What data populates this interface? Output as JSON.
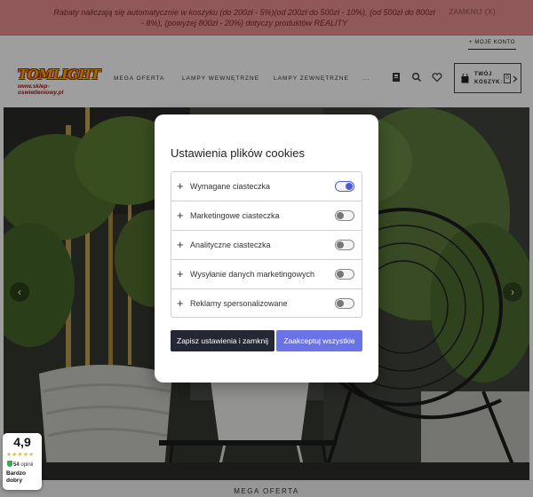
{
  "promo": {
    "text": "Rabaty naliczają się automatycznie w koszyku (do 200zł - 5%)(od 200zł do 500zł - 10%), (od 500zł do 800zł - 8%), (powyżej 800zł - 20%) dotyczy produktów REALITY",
    "close_label": "ZAMKNIJ (X)"
  },
  "header": {
    "account_label": "+ MOJE KONTO",
    "logo_text": "TOMLIGHT",
    "logo_url": "www.sklep-oswietleniowy.pl",
    "nav": [
      "MEGA OFERTA",
      "LAMPY WEWNĘTRZNE",
      "LAMPY ZEWNĘTRZNE",
      "..."
    ],
    "icons": [
      "compare-icon",
      "search-icon",
      "heart-icon"
    ],
    "cart_label": "TWÓJ KOSZYK:",
    "cart_count": "0"
  },
  "hero": {
    "arrows": [
      "‹",
      "›"
    ]
  },
  "cookie_modal": {
    "title": "Ustawienia plików cookies",
    "options": [
      {
        "label": "Wymagane ciasteczka",
        "enabled": true
      },
      {
        "label": "Marketingowe ciasteczka",
        "enabled": false
      },
      {
        "label": "Analityczne ciasteczka",
        "enabled": false
      },
      {
        "label": "Wysyłanie danych marketingowych",
        "enabled": false
      },
      {
        "label": "Reklamy spersonalizowane",
        "enabled": false
      }
    ],
    "save_label": "Zapisz ustawienia i zamknij",
    "accept_label": "Zaakceptuj wszystkie"
  },
  "rating_badge": {
    "score": "4,9",
    "stars": "★★★★★",
    "review_count": "54",
    "review_suffix": "opinii",
    "label": "Bardzo dobry"
  },
  "bottom_label": "MEGA OFERTA",
  "colors": {
    "promo_bg": "#e88f8f",
    "accept_button": "#6a72e8",
    "save_button": "#242734",
    "toggle_on": "#4a5bd8"
  }
}
